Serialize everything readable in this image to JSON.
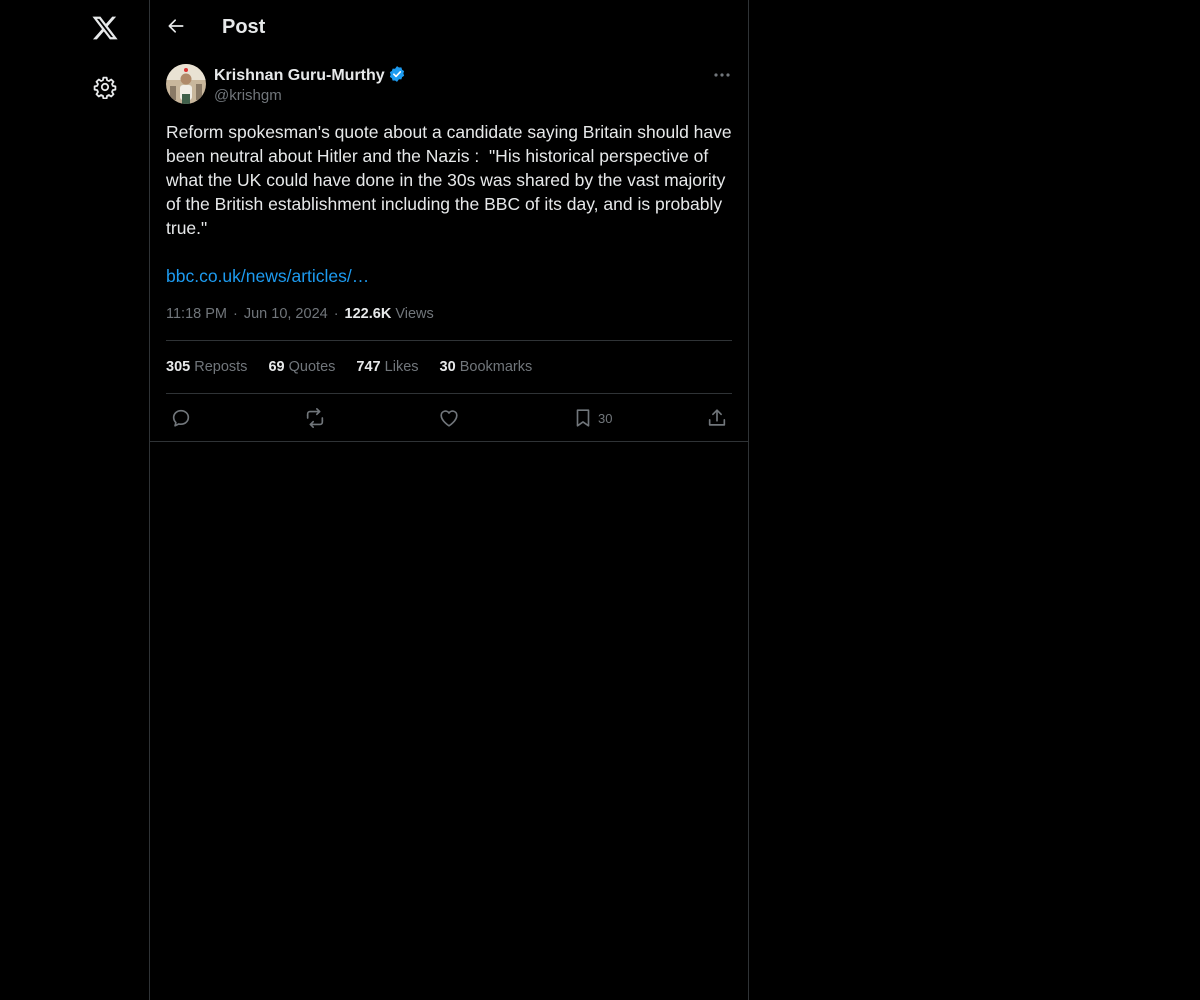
{
  "header": {
    "title": "Post"
  },
  "post": {
    "author": {
      "name": "Krishnan Guru-Murthy",
      "handle": "@krishgm",
      "verified": true
    },
    "text": "Reform spokesman's quote about a candidate saying Britain should have been neutral about Hitler and the Nazis :  \"His historical perspective of what the UK could have done in the 30s was shared by the vast majority of the British establishment including the BBC of its day, and is probably true.\"",
    "link_text": "bbc.co.uk/news/articles/…",
    "time": "11:18 PM",
    "date": "Jun 10, 2024",
    "views_count": "122.6K",
    "views_label": "Views"
  },
  "stats": {
    "reposts": {
      "count": "305",
      "label": "Reposts"
    },
    "quotes": {
      "count": "69",
      "label": "Quotes"
    },
    "likes": {
      "count": "747",
      "label": "Likes"
    },
    "bookmarks": {
      "count": "30",
      "label": "Bookmarks"
    }
  },
  "actions": {
    "bookmark_count": "30"
  },
  "icons": {
    "logo": "x-logo-icon",
    "settings": "gear-icon",
    "back": "arrow-left-icon",
    "more": "more-horizontal-icon",
    "verified": "verified-badge-icon",
    "reply": "reply-icon",
    "repost": "repost-icon",
    "like": "heart-icon",
    "bookmark": "bookmark-icon",
    "share": "share-icon"
  },
  "colors": {
    "background": "#000000",
    "text": "#e7e9ea",
    "secondary": "#71767b",
    "accent": "#1d9bf0",
    "border": "#2f3336"
  }
}
